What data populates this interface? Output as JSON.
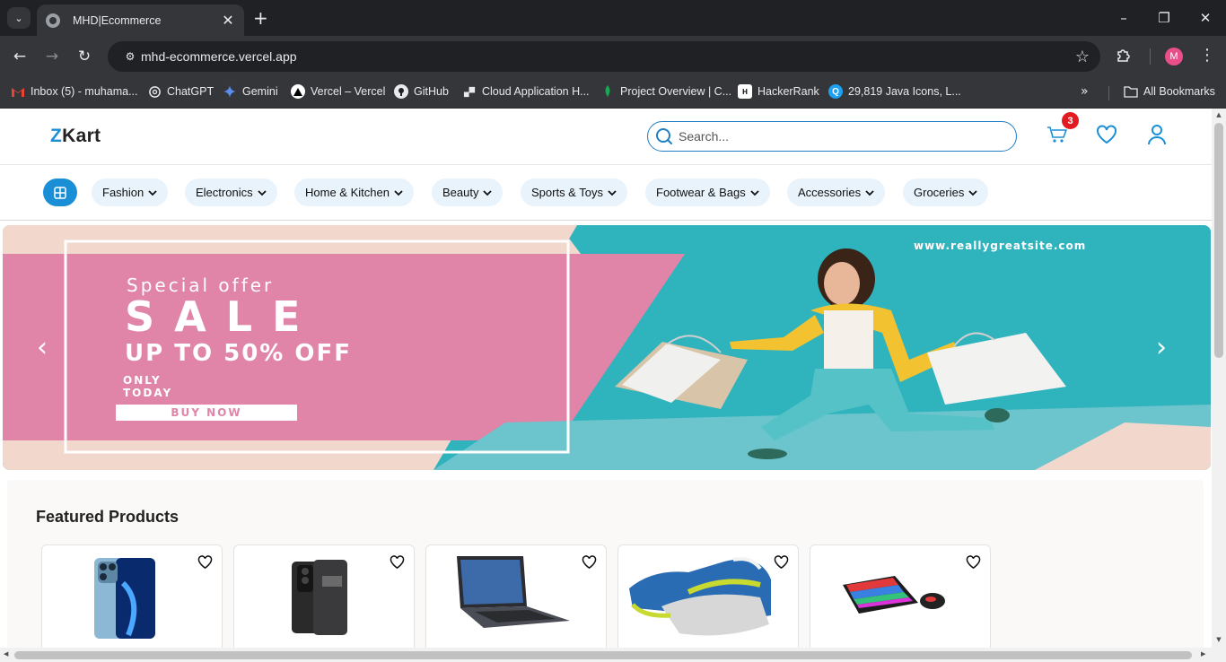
{
  "browser": {
    "tab_title": "MHD|Ecommerce",
    "url": "mhd-ecommerce.vercel.app",
    "profile_initial": "M",
    "bookmarks": [
      {
        "label": "Inbox (5) - muhama...",
        "icon": "gmail-icon"
      },
      {
        "label": "ChatGPT",
        "icon": "chatgpt-icon"
      },
      {
        "label": "Gemini",
        "icon": "gemini-icon"
      },
      {
        "label": "Vercel – Vercel",
        "icon": "vercel-icon"
      },
      {
        "label": "GitHub",
        "icon": "github-icon"
      },
      {
        "label": "Cloud Application H...",
        "icon": "cloud-icon"
      },
      {
        "label": "Project Overview | C...",
        "icon": "mongodb-icon"
      },
      {
        "label": "HackerRank",
        "icon": "hackerrank-icon"
      },
      {
        "label": "29,819 Java Icons, L...",
        "icon": "iconscout-icon"
      }
    ],
    "all_bookmarks_label": "All Bookmarks"
  },
  "site": {
    "logo_z": "Z",
    "logo_rest": "Kart",
    "search_placeholder": "Search...",
    "cart_count": "3",
    "categories": [
      "Fashion",
      "Electronics",
      "Home & Kitchen",
      "Beauty",
      "Sports & Toys",
      "Footwear & Bags",
      "Accessories",
      "Groceries"
    ]
  },
  "banner": {
    "special": "Special offer",
    "sale": "SALE",
    "discount": "UP TO 50% OFF",
    "only": "ONLY",
    "today": "TODAY",
    "cta": "BUY NOW",
    "website": "www.reallygreatsite.com"
  },
  "featured": {
    "title": "Featured Products",
    "products": [
      "iphone",
      "oneplus-phone",
      "laptop",
      "sneaker",
      "keyboard-mouse"
    ]
  },
  "colors": {
    "accent": "#1a8fd6",
    "banner_pink": "#e084a8",
    "banner_teal": "#2fb3bd",
    "badge": "#e21b23"
  }
}
